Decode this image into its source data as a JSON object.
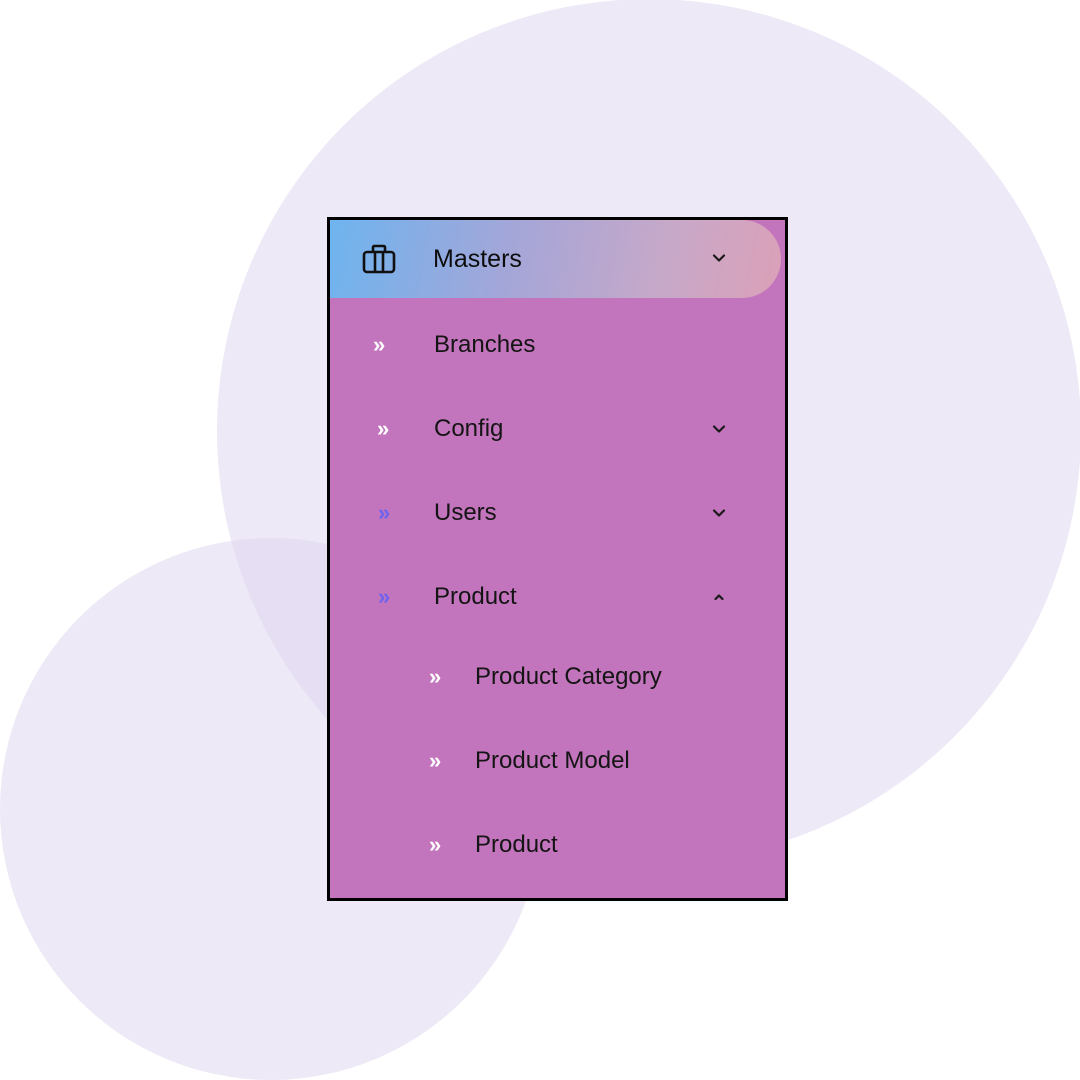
{
  "menu": {
    "title": "Masters",
    "header_icon": "briefcase-icon",
    "header_caret": "chevron-down-icon",
    "items": [
      {
        "label": "Branches",
        "icon": "double-chevron-right-icon"
      },
      {
        "label": "Config",
        "icon": "double-chevron-right-icon",
        "caret": "chevron-down-icon"
      },
      {
        "label": "Users",
        "icon": "double-chevron-right-icon",
        "caret": "chevron-down-icon"
      },
      {
        "label": "Product",
        "icon": "double-chevron-right-icon",
        "caret": "chevron-up-icon"
      }
    ],
    "subitems": [
      {
        "label": "Product Category",
        "icon": "double-chevron-right-icon"
      },
      {
        "label": "Product Model",
        "icon": "double-chevron-right-icon"
      },
      {
        "label": "Product",
        "icon": "double-chevron-right-icon"
      }
    ],
    "glyph": "»"
  },
  "colors": {
    "panel_background": "#c274bc",
    "header_gradient_start": "#6eb4ef",
    "header_gradient_end": "#dba0b8",
    "icon_white": "#ffffff",
    "icon_blue": "#6d63ee",
    "decorative_circles": "#ede6f5"
  }
}
